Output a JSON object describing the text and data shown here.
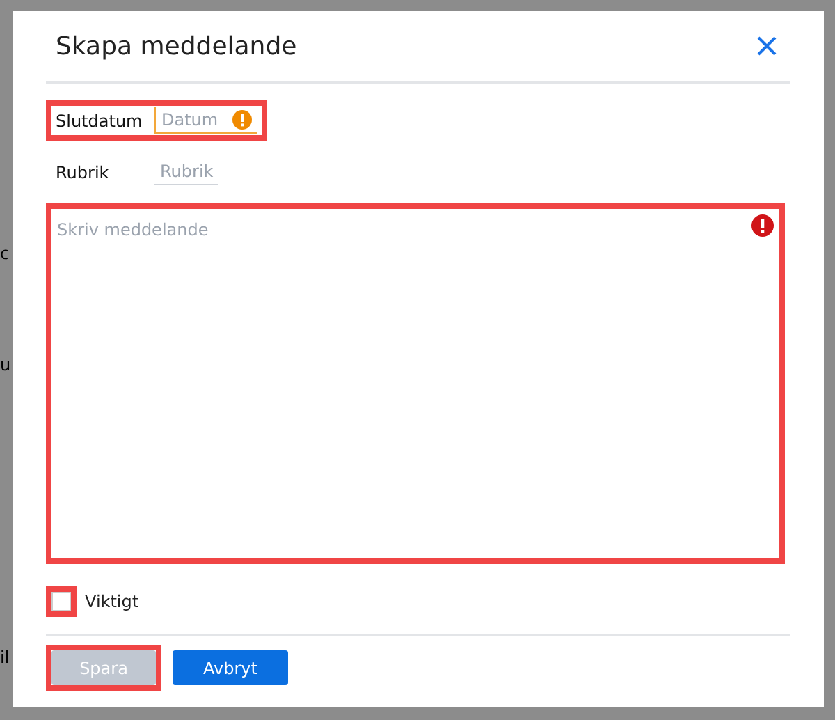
{
  "background": {
    "fragments": [
      "c",
      "u",
      "il"
    ]
  },
  "dialog": {
    "title": "Skapa meddelande",
    "fields": [
      {
        "label": "Slutdatum",
        "placeholder": "Datum",
        "warning": true,
        "highlighted": true
      },
      {
        "label": "Rubrik",
        "placeholder": "Rubrik",
        "warning": false,
        "highlighted": false
      }
    ],
    "message": {
      "placeholder": "Skriv meddelande",
      "error": true,
      "highlighted": true
    },
    "important": {
      "label": "Viktigt",
      "checked": false,
      "highlighted": true
    },
    "buttons": [
      {
        "label": "Spara",
        "kind": "primary",
        "disabled": true,
        "highlighted": true
      },
      {
        "label": "Avbryt",
        "kind": "secondary",
        "disabled": false,
        "highlighted": false
      }
    ]
  }
}
